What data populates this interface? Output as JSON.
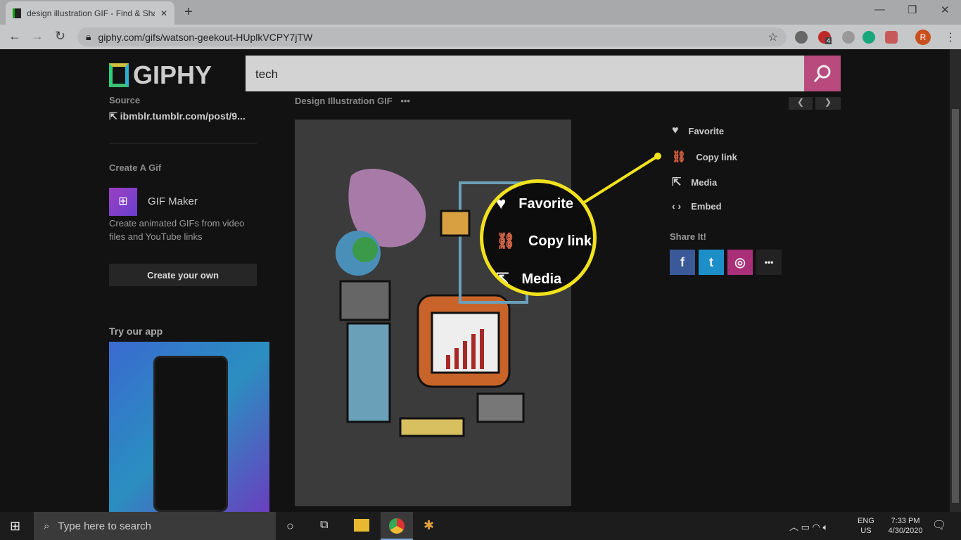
{
  "browser": {
    "tab_title": "design illustration GIF - Find & Share on GIPHY",
    "url": "giphy.com/gifs/watson-geekout-HUplkVCPY7jTW",
    "extension_badge": "4",
    "profile_initial": "R"
  },
  "header": {
    "logo": "GIPHY",
    "search_value": "tech"
  },
  "sidebar": {
    "source_label": "Source",
    "source_link": "ibmblr.tumblr.com/post/9...",
    "create_label": "Create A Gif",
    "gif_maker_title": "GIF Maker",
    "gif_maker_desc": "Create animated GIFs from video files and YouTube links",
    "create_own": "Create your own",
    "app_label": "Try our app"
  },
  "main": {
    "gif_title": "Design Illustration GIF",
    "more": "•••"
  },
  "actions": [
    {
      "label": "Favorite",
      "icon": "heart-icon"
    },
    {
      "label": "Copy link",
      "icon": "link-icon"
    },
    {
      "label": "Media",
      "icon": "share-arrow-icon"
    },
    {
      "label": "Embed",
      "icon": "code-icon"
    }
  ],
  "share": {
    "label": "Share It!",
    "buttons": [
      {
        "name": "facebook",
        "glyph": "f",
        "color": "#3b5998"
      },
      {
        "name": "twitter",
        "glyph": "t",
        "color": "#1da1f2"
      },
      {
        "name": "instagram",
        "glyph": "◎",
        "color": "#c13584"
      },
      {
        "name": "more",
        "glyph": "•••",
        "color": "#222222"
      }
    ]
  },
  "callout": {
    "items": [
      "Favorite",
      "Copy link",
      "Media"
    ],
    "color": "#f2e21e"
  },
  "taskbar": {
    "search_placeholder": "Type here to search",
    "lang": "ENG",
    "region": "US",
    "time": "7:33 PM",
    "date": "4/30/2020"
  }
}
